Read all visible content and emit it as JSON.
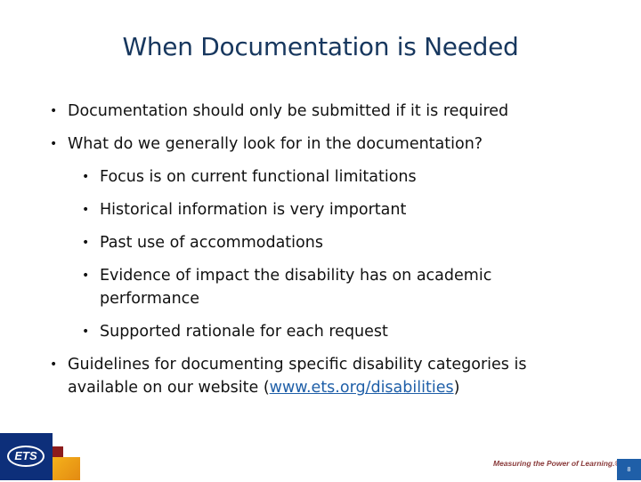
{
  "slide": {
    "title": "When Documentation is Needed",
    "bullets": [
      {
        "text": "Documentation should only be submitted if it is required"
      },
      {
        "text": "What do we generally look for in the documentation?"
      }
    ],
    "sub_bullets": [
      {
        "text": "Focus is on current functional limitations"
      },
      {
        "text": "Historical information is very important"
      },
      {
        "text": "Past use of accommodations"
      },
      {
        "text": "Evidence of impact the disability has on academic performance"
      },
      {
        "text": "Supported rationale for each request"
      }
    ],
    "final_bullet": {
      "text_before": "Guidelines for documenting specific disability categories is available on our website (",
      "link": "www.ets.org/disabilities",
      "text_after": ")"
    },
    "bullet_glyph": "•"
  },
  "footer": {
    "logo_text": "ETS",
    "tagline": "Measuring the Power of Learning.®",
    "page_number": "8",
    "colors": {
      "logo_blue": "#0d2f7a",
      "logo_red": "#8c1c1c",
      "logo_orange": "#f5b21b",
      "page_box": "#1f5fa8"
    }
  }
}
